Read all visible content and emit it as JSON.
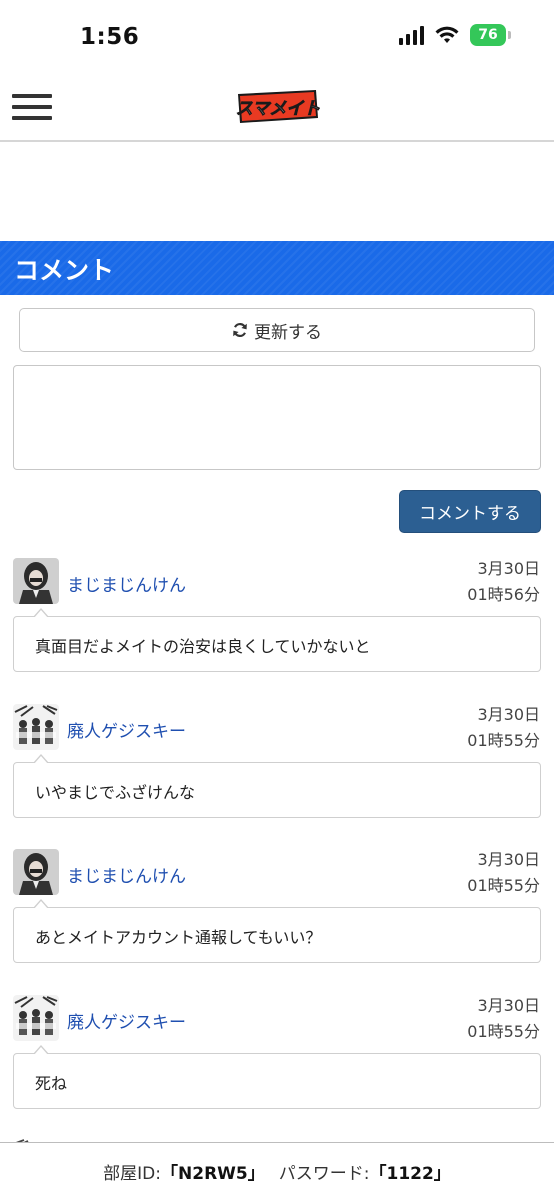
{
  "status_bar": {
    "time": "1:56",
    "battery": "76"
  },
  "header": {
    "logo_text": "スマメイト"
  },
  "section": {
    "title": "コメント"
  },
  "refresh": {
    "label": "更新する"
  },
  "compose": {
    "submit_label": "コメントする",
    "value": ""
  },
  "comments": [
    {
      "user": "まじまじんけん",
      "date": "3月30日",
      "time": "01時56分",
      "text": "真面目だよメイトの治安は良くしていかないと"
    },
    {
      "user": "廃人ゲジスキー",
      "date": "3月30日",
      "time": "01時55分",
      "text": "いやまじでふざけんな"
    },
    {
      "user": "まじまじんけん",
      "date": "3月30日",
      "time": "01時55分",
      "text": "あとメイトアカウント通報してもいい？"
    },
    {
      "user": "廃人ゲジスキー",
      "date": "3月30日",
      "time": "01時55分",
      "text": "死ね"
    }
  ],
  "footer": {
    "room_id_label": "部屋ID:",
    "room_id": "「N2RW5」",
    "password_label": "パスワード:",
    "password": "「1122」"
  },
  "colors": {
    "section_bar": "#1a6ae8",
    "submit": "#2c5f92",
    "user_link": "#1f4fb0",
    "battery": "#34c759"
  }
}
